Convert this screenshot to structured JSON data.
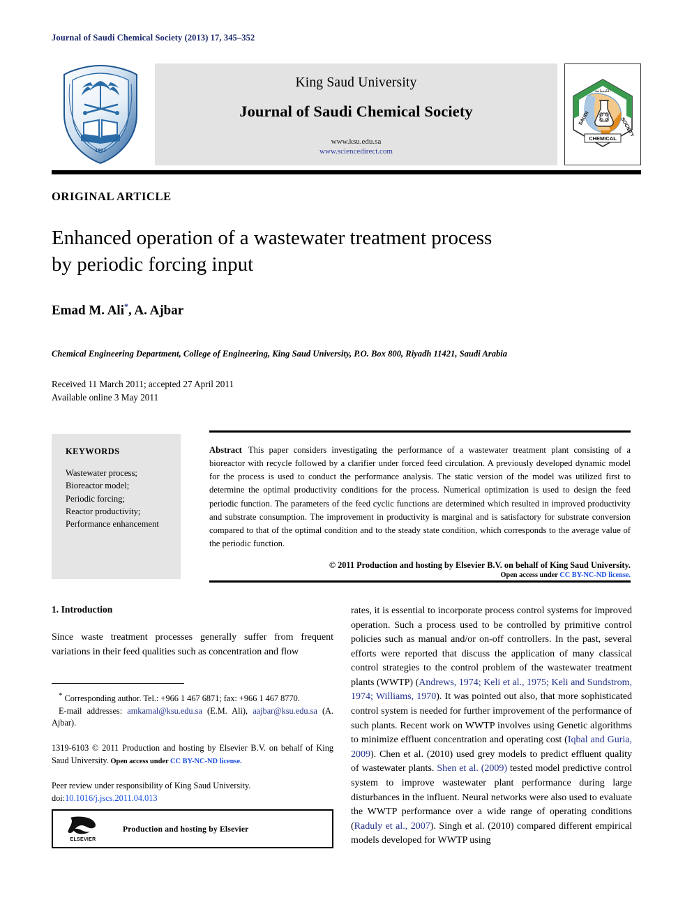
{
  "running_head": "Journal of Saudi Chemical Society (2013) 17, 345–352",
  "masthead": {
    "university": "King Saud University",
    "journal": "Journal of Saudi Chemical Society",
    "url_primary": "www.ksu.edu.sa",
    "url_secondary": "www.sciencedirect.com",
    "ksu_logo_year": "1957",
    "scs_logo_text_left": "SAUDI",
    "scs_logo_text_right": "SOCIETY",
    "scs_logo_text_bottom": "CHEMICAL"
  },
  "article_type": "ORIGINAL ARTICLE",
  "title": {
    "line1": "Enhanced operation of a wastewater treatment process",
    "line2": "by periodic forcing input"
  },
  "authors": {
    "text": "Emad M. Ali",
    "marker": "*",
    "rest": ", A. Ajbar"
  },
  "affiliation": "Chemical Engineering Department, College of Engineering, King Saud University, P.O. Box 800, Riyadh 11421, Saudi Arabia",
  "history": {
    "line1": "Received 11 March 2011; accepted 27 April 2011",
    "line2": "Available online 3 May 2011"
  },
  "keywords": {
    "heading": "KEYWORDS",
    "items": [
      "Wastewater process;",
      "Bioreactor model;",
      "Periodic forcing;",
      "Reactor productivity;",
      "Performance enhancement"
    ]
  },
  "abstract": {
    "label": "Abstract",
    "body": "This paper considers investigating the performance of a wastewater treatment plant consisting of a bioreactor with recycle followed by a clarifier under forced feed circulation. A previously developed dynamic model for the process is used to conduct the performance analysis. The static version of the model was utilized first to determine the optimal productivity conditions for the process. Numerical optimization is used to design the feed periodic function. The parameters of the feed cyclic functions are determined which resulted in improved productivity and substrate consumption. The improvement in productivity is marginal and is satisfactory for substrate conversion compared to that of the optimal condition and to the steady state condition, which corresponds to the average value of the periodic function.",
    "copyright": "© 2011 Production and hosting by Elsevier B.V. on behalf of King Saud University.",
    "open_access_prefix": "Open access under ",
    "open_access_link": "CC BY-NC-ND license."
  },
  "left_column": {
    "section_heading": "1. Introduction",
    "paragraph": "Since waste treatment processes generally suffer from frequent variations in their feed qualities such as concentration and flow"
  },
  "footnotes": {
    "corresponding_marker": "*",
    "corresponding": " Corresponding author. Tel.: +966 1 467 6871; fax: +966 1 467 8770.",
    "email_label": "E-mail addresses:",
    "email1": "amkamal@ksu.edu.sa",
    "email1_owner": " (E.M. Ali),",
    "email2": "aajbar@ksu.edu.sa",
    "email2_owner": " (A. Ajbar)."
  },
  "copyright_block": {
    "issn_line": "1319-6103 © 2011 Production and hosting by Elsevier B.V. on behalf of King Saud University.",
    "open_access_prefix": " Open access under ",
    "open_access_link": "CC BY-NC-ND license."
  },
  "peer_block": {
    "line1": "Peer review under responsibility of King Saud University.",
    "doi_label": "doi:",
    "doi_value": "10.1016/j.jscs.2011.04.013"
  },
  "elsevier_box": {
    "brand": "ELSEVIER",
    "text": "Production and hosting by Elsevier"
  },
  "right_column": {
    "paragraph_parts": [
      {
        "type": "text",
        "value": "rates, it is essential to incorporate process control systems for improved operation. Such a process used to be controlled by primitive control policies such as manual and/or on-off controllers. In the past, several efforts were reported that discuss the application of many classical control strategies to the control problem of the wastewater treatment plants (WWTP) ("
      },
      {
        "type": "link",
        "value": "Andrews, 1974; Keli et al., 1975; Keli and Sundstrom, 1974; Williams, 1970"
      },
      {
        "type": "text",
        "value": "). It was pointed out also, that more sophisticated control system is needed for further improvement of the performance of such plants. Recent work on WWTP involves using Genetic algorithms to minimize effluent concentration and operating cost ("
      },
      {
        "type": "link",
        "value": "Iqbal and Guria, 2009"
      },
      {
        "type": "text",
        "value": "). Chen et al. (2010) used grey models to predict effluent quality of wastewater plants. "
      },
      {
        "type": "link",
        "value": "Shen et al. (2009)"
      },
      {
        "type": "text",
        "value": " tested model predictive control system to improve wastewater plant performance during large disturbances in the influent. Neural networks were also used to evaluate the WWTP performance over a wide range of operating conditions ("
      },
      {
        "type": "link",
        "value": "Raduly et al., 2007"
      },
      {
        "type": "text",
        "value": "). Singh et al. (2010) compared different empirical models developed for WWTP using"
      }
    ]
  },
  "colors": {
    "running_head": "#1b2a6b",
    "link_blue": "#1a4fe0",
    "ref_blue": "#22318a",
    "banner_bg": "#e3e3e3",
    "keywords_bg": "#e5e5e5"
  }
}
